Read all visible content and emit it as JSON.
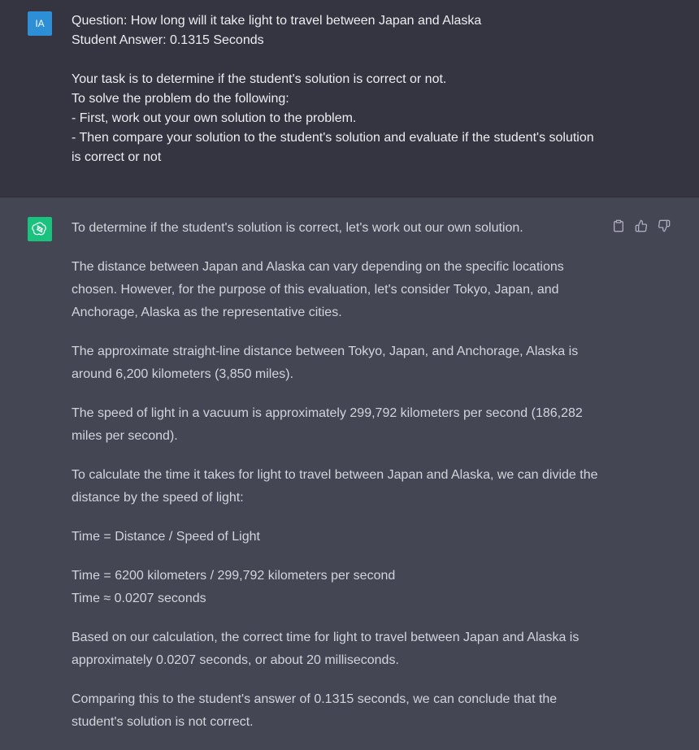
{
  "user": {
    "avatar_initials": "IA",
    "lines": [
      "Question: How long will it take light to travel between Japan and Alaska",
      "Student Answer: 0.1315 Seconds",
      "",
      "Your task is to determine if the student's solution is correct or not.",
      "To solve the problem do the following:",
      "- First, work out your own solution to the problem.",
      "- Then compare your solution to the student's solution and evaluate if the student's solution is correct or not"
    ]
  },
  "assistant": {
    "avatar_icon": "openai-logo-icon",
    "paragraphs": [
      "To determine if the student's solution is correct, let's work out our own solution.",
      "The distance between Japan and Alaska can vary depending on the specific locations chosen. However, for the purpose of this evaluation, let's consider Tokyo, Japan, and Anchorage, Alaska as the representative cities.",
      "The approximate straight-line distance between Tokyo, Japan, and Anchorage, Alaska is around 6,200 kilometers (3,850 miles).",
      "The speed of light in a vacuum is approximately 299,792 kilometers per second (186,282 miles per second).",
      "To calculate the time it takes for light to travel between Japan and Alaska, we can divide the distance by the speed of light:",
      "Time = Distance / Speed of Light",
      "Time = 6200 kilometers / 299,792 kilometers per second\nTime ≈ 0.0207 seconds",
      "Based on our calculation, the correct time for light to travel between Japan and Alaska is approximately 0.0207 seconds, or about 20 milliseconds.",
      "Comparing this to the student's answer of 0.1315 seconds, we can conclude that the student's solution is not correct."
    ]
  },
  "actions": {
    "icons": [
      "clipboard-icon",
      "thumbs-up-icon",
      "thumbs-down-icon"
    ]
  },
  "colors": {
    "user_bg": "#343541",
    "assistant_bg": "#444654",
    "user_avatar": "#2d8fd5",
    "assistant_avatar": "#19c37d"
  }
}
